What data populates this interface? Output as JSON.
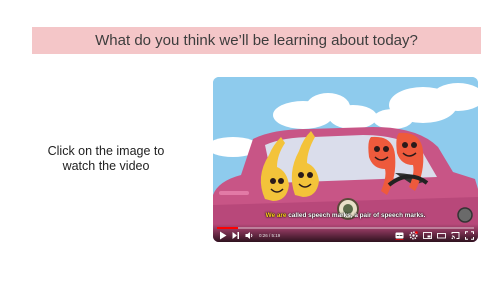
{
  "slide": {
    "title": "What do you think we’ll be learning about today?",
    "instruction": "Click on the image to watch the video"
  },
  "video": {
    "subtitle_highlight": "We are",
    "subtitle_rest": " called speech marks, a pair of speech marks.",
    "time": "0:26 / 5:19",
    "progress": 0.08,
    "colors": {
      "sky": "#8ecbed",
      "car": "#c85586",
      "yellow_mark": "#f3c33a",
      "red_mark": "#ee5a3c",
      "progress": "#ff0000",
      "title_bar": "#f4c6c8"
    },
    "icons": [
      "play-icon",
      "next-icon",
      "volume-icon",
      "subtitles-icon",
      "settings-icon",
      "miniplayer-icon",
      "theater-icon",
      "cast-icon",
      "fullscreen-icon"
    ]
  }
}
